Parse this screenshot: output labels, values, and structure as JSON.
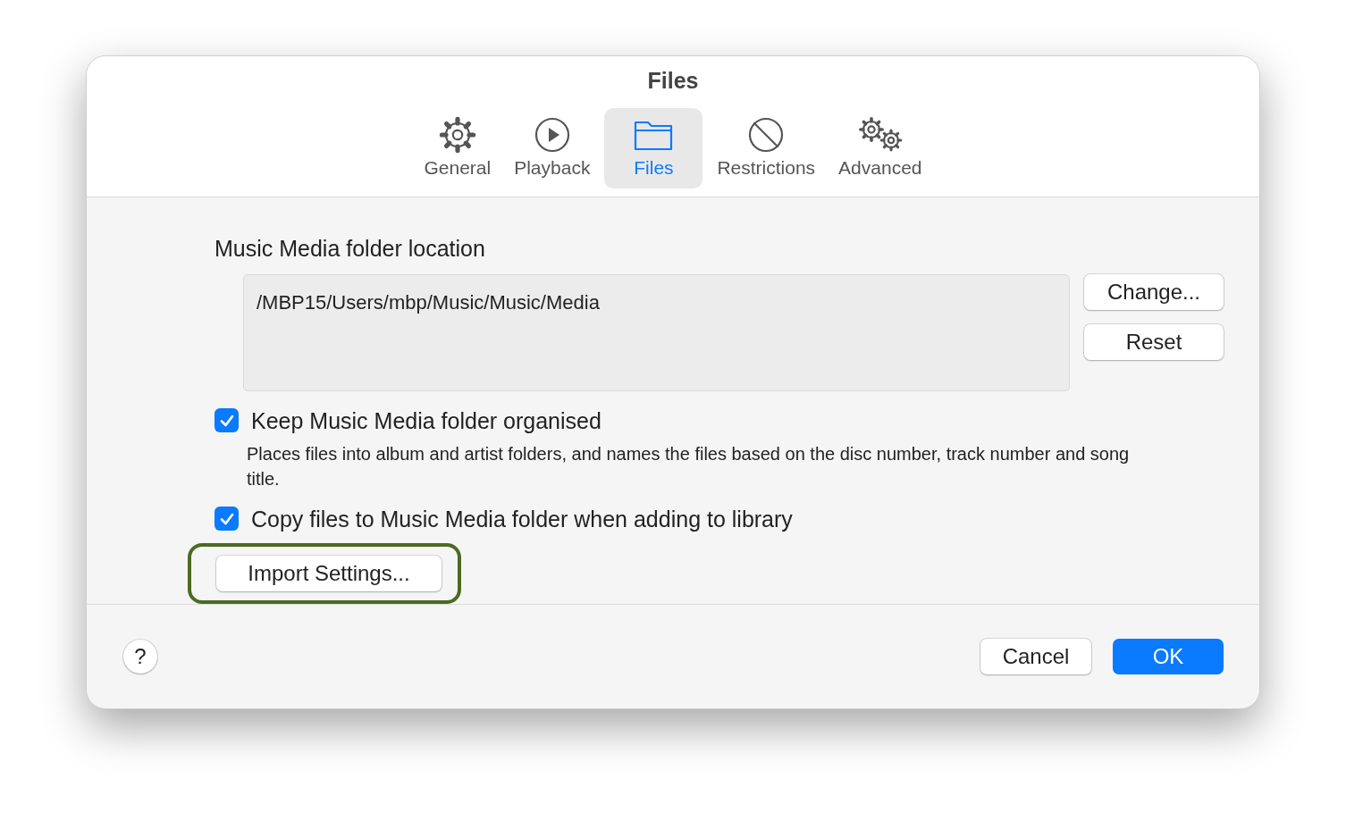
{
  "window": {
    "title": "Files"
  },
  "tabs": [
    {
      "label": "General",
      "selected": false
    },
    {
      "label": "Playback",
      "selected": false
    },
    {
      "label": "Files",
      "selected": true
    },
    {
      "label": "Restrictions",
      "selected": false
    },
    {
      "label": "Advanced",
      "selected": false
    }
  ],
  "location": {
    "heading": "Music Media folder location",
    "path": "/MBP15/Users/mbp/Music/Music/Media",
    "buttons": [
      "Change...",
      "Reset"
    ]
  },
  "options": [
    {
      "label": "Keep Music Media folder organised",
      "checked": true,
      "description": "Places files into album and artist folders, and names the files based on the disc number, track number and song title."
    },
    {
      "label": "Copy files to Music Media folder when adding to library",
      "checked": true
    }
  ],
  "import_button": {
    "label": "Import Settings...",
    "highlighted": true
  },
  "footer": {
    "help": "?",
    "buttons": [
      {
        "label": "Cancel",
        "kind": "secondary"
      },
      {
        "label": "OK",
        "kind": "primary"
      }
    ]
  }
}
